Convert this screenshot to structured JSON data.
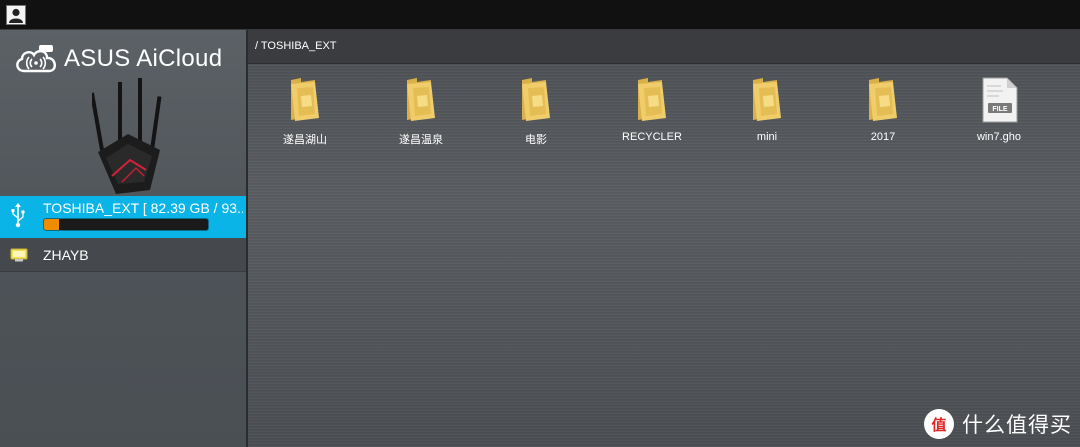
{
  "topbar": {
    "user_icon": "user-icon"
  },
  "sidebar": {
    "logo_text": "ASUS AiCloud",
    "logo_icon": "cloud-icon",
    "devices": [
      {
        "name": "TOSHIBA_EXT [ 82.39 GB / 93...",
        "icon": "usb-icon",
        "usage_fraction": 0.09,
        "selected": true
      },
      {
        "name": "ZHAYB",
        "icon": "computer-icon",
        "selected": false
      }
    ]
  },
  "main": {
    "path": "/ TOSHIBA_EXT",
    "files": [
      {
        "name": "遂昌湖山",
        "type": "folder"
      },
      {
        "name": "遂昌温泉",
        "type": "folder"
      },
      {
        "name": "电影",
        "type": "folder"
      },
      {
        "name": "RECYCLER",
        "type": "folder"
      },
      {
        "name": "mini",
        "type": "folder"
      },
      {
        "name": "2017",
        "type": "folder"
      },
      {
        "name": "win7.gho",
        "type": "file",
        "badge": "FILE"
      }
    ]
  },
  "watermark": {
    "text": "什么值得买",
    "symbol": "值"
  },
  "colors": {
    "accent": "#0bb4e6",
    "usage": "#f08c00",
    "folder": "#e8c15a"
  }
}
